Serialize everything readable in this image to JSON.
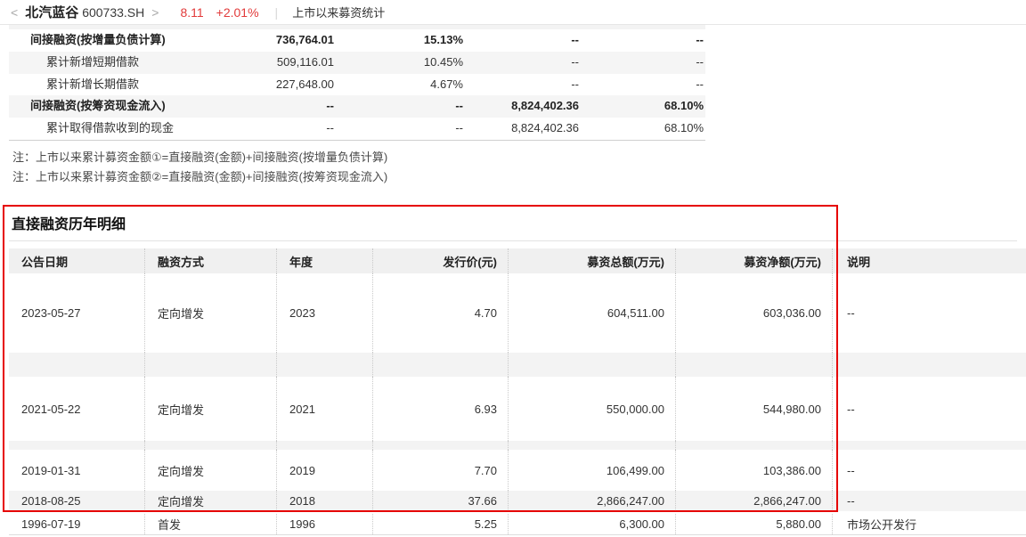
{
  "topbar": {
    "back_icon": "<",
    "forward_icon": ">",
    "stock_name": "北汽蓝谷",
    "stock_code": "600733.SH",
    "price": "8.11",
    "change": "+2.01%",
    "divider": "|",
    "page_title": "上市以来募资统计"
  },
  "indirect_table": {
    "rows": [
      {
        "label": "间接融资(按增量负债计算)",
        "v1": "736,764.01",
        "v2": "15.13%",
        "v3": "--",
        "v4": "--"
      },
      {
        "label": "累计新增短期借款",
        "v1": "509,116.01",
        "v2": "10.45%",
        "v3": "--",
        "v4": "--"
      },
      {
        "label": "累计新增长期借款",
        "v1": "227,648.00",
        "v2": "4.67%",
        "v3": "--",
        "v4": "--"
      },
      {
        "label": "间接融资(按筹资现金流入)",
        "v1": "--",
        "v2": "--",
        "v3": "8,824,402.36",
        "v4": "68.10%"
      },
      {
        "label": "累计取得借款收到的现金",
        "v1": "--",
        "v2": "--",
        "v3": "8,824,402.36",
        "v4": "68.10%"
      }
    ]
  },
  "notes": [
    "注：上市以来累计募资金额①=直接融资(金额)+间接融资(按增量负债计算)",
    "注：上市以来累计募资金额②=直接融资(金额)+间接融资(按筹资现金流入)"
  ],
  "direct_section": {
    "title": "直接融资历年明细",
    "headers": [
      "公告日期",
      "融资方式",
      "年度",
      "发行价(元)",
      "募资总额(万元)",
      "募资净额(万元)",
      "说明"
    ],
    "rows": [
      [
        "2023-05-27",
        "定向增发",
        "2023",
        "4.70",
        "604,511.00",
        "603,036.00",
        "--"
      ],
      [
        "2021-05-22",
        "定向增发",
        "2021",
        "6.93",
        "550,000.00",
        "544,980.00",
        "--"
      ],
      [
        "2019-01-31",
        "定向增发",
        "2019",
        "7.70",
        "106,499.00",
        "103,386.00",
        "--"
      ],
      [
        "2018-08-25",
        "定向增发",
        "2018",
        "37.66",
        "2,866,247.00",
        "2,866,247.00",
        "--"
      ],
      [
        "1996-07-19",
        "首发",
        "1996",
        "5.25",
        "6,300.00",
        "5,880.00",
        "市场公开发行"
      ]
    ]
  },
  "colors": {
    "accent_red": "#e60000",
    "price_red": "#e23b3b",
    "zebra_gray": "#f5f5f5"
  }
}
